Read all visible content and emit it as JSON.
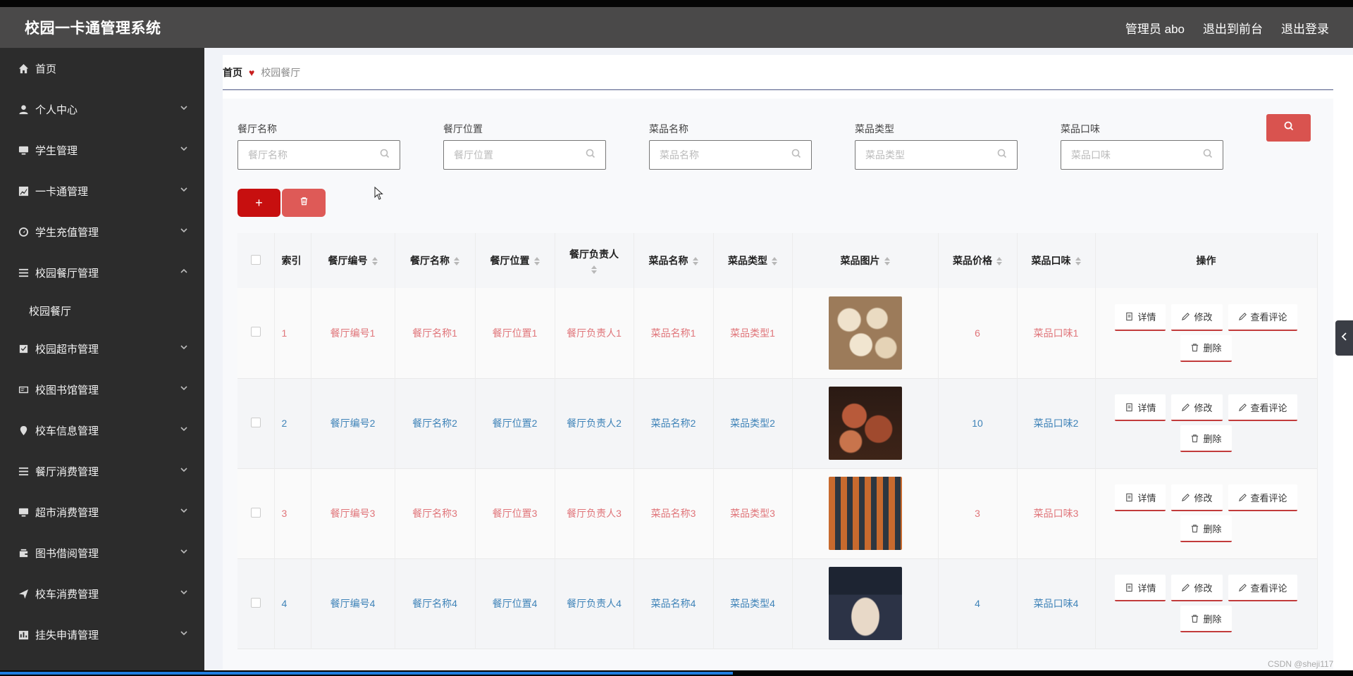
{
  "header": {
    "title": "校园一卡通管理系统",
    "actions": [
      "管理员 abo",
      "退出到前台",
      "退出登录"
    ]
  },
  "sidebar": {
    "items": [
      {
        "label": "首页",
        "icon": "home-icon",
        "expandable": false
      },
      {
        "label": "个人中心",
        "icon": "user-icon",
        "expandable": true
      },
      {
        "label": "学生管理",
        "icon": "monitor-icon",
        "expandable": true
      },
      {
        "label": "一卡通管理",
        "icon": "chart-icon",
        "expandable": true
      },
      {
        "label": "学生充值管理",
        "icon": "gauge-icon",
        "expandable": true
      },
      {
        "label": "校园餐厅管理",
        "icon": "list-icon",
        "expandable": true,
        "expanded": true
      },
      {
        "label": "校园超市管理",
        "icon": "check-icon",
        "expandable": true
      },
      {
        "label": "校图书馆管理",
        "icon": "card-icon",
        "expandable": true
      },
      {
        "label": "校车信息管理",
        "icon": "location-icon",
        "expandable": true
      },
      {
        "label": "餐厅消费管理",
        "icon": "list-icon",
        "expandable": true
      },
      {
        "label": "超市消费管理",
        "icon": "monitor-icon",
        "expandable": true
      },
      {
        "label": "图书借阅管理",
        "icon": "wallet-icon",
        "expandable": true
      },
      {
        "label": "校车消费管理",
        "icon": "send-icon",
        "expandable": true
      },
      {
        "label": "挂失申请管理",
        "icon": "report-icon",
        "expandable": true
      }
    ],
    "submenu": [
      "校园餐厅"
    ]
  },
  "breadcrumb": {
    "home": "首页",
    "current": "校园餐厅"
  },
  "filters": [
    {
      "label": "餐厅名称",
      "placeholder": "餐厅名称"
    },
    {
      "label": "餐厅位置",
      "placeholder": "餐厅位置"
    },
    {
      "label": "菜品名称",
      "placeholder": "菜品名称"
    },
    {
      "label": "菜品类型",
      "placeholder": "菜品类型"
    },
    {
      "label": "菜品口味",
      "placeholder": "菜品口味"
    }
  ],
  "toolbar": {
    "add_label": "+"
  },
  "table": {
    "columns": [
      "索引",
      "餐厅编号",
      "餐厅名称",
      "餐厅位置",
      "餐厅负责人",
      "菜品名称",
      "菜品类型",
      "菜品图片",
      "菜品价格",
      "菜品口味",
      "操作"
    ],
    "rows": [
      {
        "index": "1",
        "code": "餐厅编号1",
        "name": "餐厅名称1",
        "location": "餐厅位置1",
        "manager": "餐厅负责人1",
        "dish": "菜品名称1",
        "type": "菜品类型1",
        "price": "6",
        "taste": "菜品口味1"
      },
      {
        "index": "2",
        "code": "餐厅编号2",
        "name": "餐厅名称2",
        "location": "餐厅位置2",
        "manager": "餐厅负责人2",
        "dish": "菜品名称2",
        "type": "菜品类型2",
        "price": "10",
        "taste": "菜品口味2"
      },
      {
        "index": "3",
        "code": "餐厅编号3",
        "name": "餐厅名称3",
        "location": "餐厅位置3",
        "manager": "餐厅负责人3",
        "dish": "菜品名称3",
        "type": "菜品类型3",
        "price": "3",
        "taste": "菜品口味3"
      },
      {
        "index": "4",
        "code": "餐厅编号4",
        "name": "餐厅名称4",
        "location": "餐厅位置4",
        "manager": "餐厅负责人4",
        "dish": "菜品名称4",
        "type": "菜品类型4",
        "price": "4",
        "taste": "菜品口味4"
      }
    ],
    "actions": {
      "detail": "详情",
      "edit": "修改",
      "comments": "查看评论",
      "delete": "删除"
    }
  },
  "watermark": "CSDN @sheji117",
  "colors": {
    "accent": "#d9534f",
    "add": "#c70f0f",
    "link_red": "#e0757a",
    "link_blue": "#3f83b8",
    "sidebar": "#2c2c2c",
    "header": "#4a4949"
  }
}
